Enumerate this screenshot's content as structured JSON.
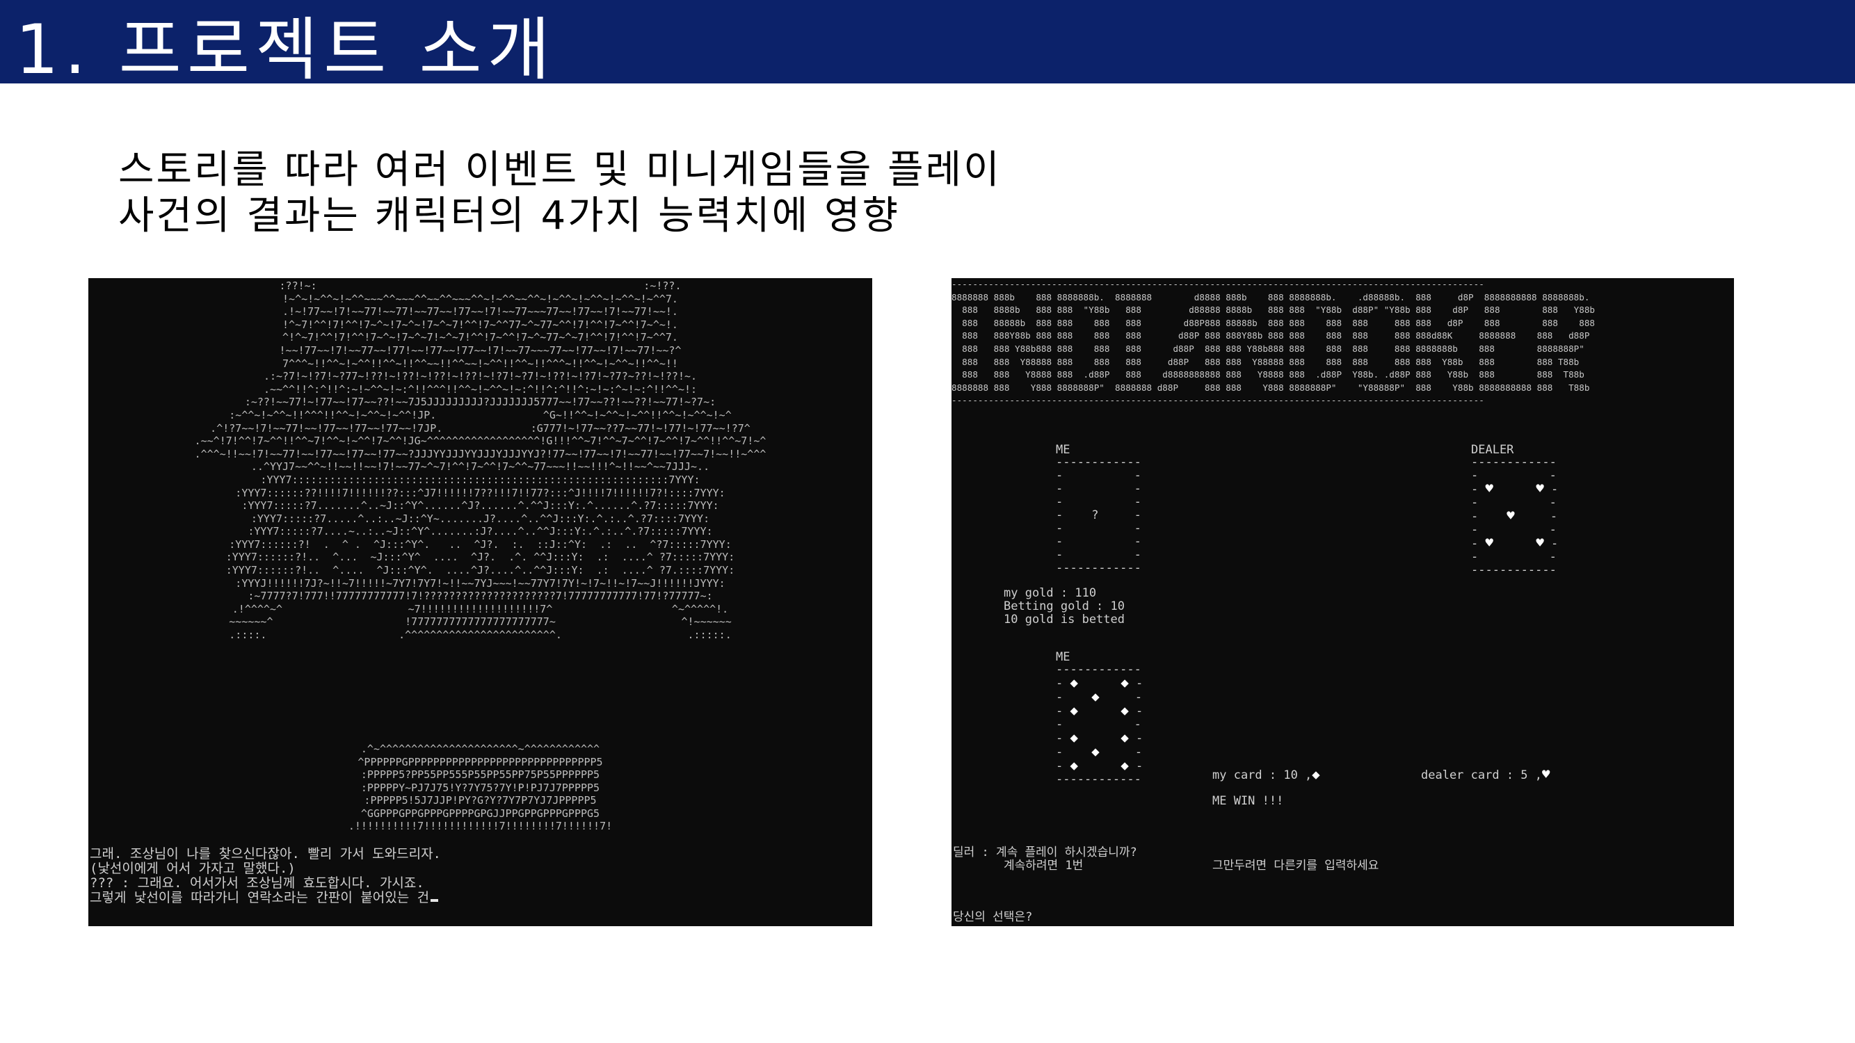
{
  "header": {
    "title": "1. 프로젝트 소개"
  },
  "intro": {
    "line1": "스토리를 따라 여러 이벤트 및 미니게임들을 플레이",
    "line2": "사건의 결과는 캐릭터의 4가지 능력치에 영향"
  },
  "story_console": {
    "ascii_art": ":??!~:                                                    :~!??.\n!~^~!~^^~!~^^~~~^^~~~^^~~^^~~~^^~!~^^~~^^~!~^^~!~^^~!~^^~!~^^7.\n.!~!77~~!7!~~77!~~77!~~77~~!77~~!7!~~77~~~77~~!77~~!7!~~77!~~!.\n!^~7!^^!7!^^!7~^~!7~^~!7~^~7!^^!7~^^77~^~77~^^!7!^^!7~^^!7~^~!.\n^!^~7!^^!7!^^!7~^~!7~^~7!~^~7!^^!7~^^!7~^~77~^~7!^^!7!^^!7~^^7.\n!~~!77~~!7!~~77~~!77!~~!77~~!77~~!7!~~77~~~77~~!77~~!7!~~77!~~?^\n7^^^~!!^^~!~^^!!^^~!!^^~~!!^^~~!~^^!!^^~!!^^^~!!^^~!~^^~!!^^~!!\n.:~?7!~!?7!~?77~!??!~!??!~!??!~!??!~!?7!~?7!~!??!~!?7!~?7?~??!~!??!~.\n.~~^^!!^:^!!^:~!~^^~!~:^!!^^^!!^^~!~^^~!~:^!!^:^!!^:~!~:^~!~:^!!^^~!:\n:~??!~~77!~!77~~!77~~??!~~7J5JJJJJJJJJ?JJJJJJJ5777~~!77~~??!~~??!~~77!~?7~:\n:~^^~!~^^~!!^^^!!^^~!~^^~!~^^!JP.                 ^G~!!^^~!~^^~!~^^!!^^~!~^^~!~^\n.^!?7~~!7!~~77!~~!77~~!77~~!77~~!7JP.              :G777!~!77~~??7~~77!~!77!~!77~~!?7^\n.~~^!7!^^!7~^^!!^^~7!^^~!~^^!7~^^!JG~^^^^^^^^^^^^^^^^^^!G!!!^^~7!^^~7~^^!7~^^!7~^^!!^^~7!~^\n.^^^~!!~~!7!~~77!~~!77~~!77~~!77~~?JJJYYJJJYYJJJYJJJYYJ?!77~~!77~~!7!~~77!~~!77~~7!~~!!~^^^\n..^YYJ7~~^^~!!~~!!~~!7!~~77~^~7!^^!7~^^!7~^^~77~~~!!~~!!!^~!!~~^~~7JJJ~..\n:YYY7::::::::::::::::::::::::::::::::::::::::::::::::::::::::::::7YYY:\n:YYY7::::::??!!!!7!!!!!!??:::^J7!!!!!!7??!!!7!!77?:::^J!!!!7!!!!!!7?!::::7YYY:\n:YYY7:::::?7.......^..~J::^Y^......^J?......^.^^J:::Y:.^......^.?7:::::7YYY:\n:YYY7:::::?7.....^..:..~J::^Y~.......J?....^..^^J:::Y:.^.:..^.?7::::7YYY:\n:YYY7:::::?7....~..:..~J::^Y^.......:J?....^..^^J:::Y:.^.:..^.?7:::::7YYY:\n:YYY7::::::?!  .  ^ .  ^J:::^Y^.   ..  ^J?.  :.  ::J::^Y:  .:  ..  ^?7:::::7YYY:\n:YYY7::::::?!..  ^...  ~J:::^Y^  ....  ^J?.  .^. ^^J:::Y:  .:  ....^ ?7:::::7YYY:\n:YYY7::::::?!..  ^....  ^J:::^Y^.  ....^J?....^..^^J:::Y:  .:  ....^ ?7.::::7YYY:\n:YYYJ!!!!!!7J?~!!~7!!!!!~7Y7!7Y7!~!!~~7YJ~~~!~~77Y7!7Y!~!7~!!~!7~~J!!!!!!JYYY:\n:~7777?7!777!!77777777777!7!?????????????????????7!77777777777!77!?77777~:\n.!^^^^~^                    ~7!!!!!!!!!!!!!!!!!!!7^                   ^~^^^^^!.\n~~~~~~^                     !7777777777777777777777~                    ^!~~~~~~\n.::::.                     .^^^^^^^^^^^^^^^^^^^^^^^^.                    .:::::.",
    "minigame_art": ".^~^^^^^^^^^^^^^^^^^^^^^^~^^^^^^^^^^^^\n^PPPPPPGPPPPPPPPPPPPPPPPPPPPPPPPPPPPPP5\n:PPPPP5?PP55PP555P55PP55PP75P55PPPPPP5\n:PPPPPY~PJ7J75!Y?7Y75?7Y!P!PJ7J7PPPPP5\n:PPPPP5!5J7JJP!PY?G?Y?7Y7P7YJ7JPPPPP5\n^GGPPPGPPGPPPGPPPPGPGJJPPGPPGPPPGPPPG5\n.!!!!!!!!!!7!!!!!!!!!!!!7!!!!!!!!7!!!!!!7!",
    "dialog": [
      "그래. 조상님이 나를 찾으신다잖아. 빨리 가서 도와드리자.",
      "(낯선이에게 어서 가자고 말했다.)",
      "??? : 그래요. 어서가서 조상님께 효도합시다. 가시죠.",
      "그렇게 낯선이를 따라가니 연락소라는 간판이 붙어있는 건"
    ]
  },
  "game_console": {
    "banner": "-----------------------------------------------------------------------------------------------------\n8888888 888b    888 8888888b.  8888888        d8888 888b    888 8888888b.    .d88888b.  888     d8P  8888888888 8888888b.\n  888   8888b   888 888  \"Y88b   888         d88888 8888b   888 888  \"Y88b  d88P\" \"Y88b 888    d8P   888        888   Y88b\n  888   88888b  888 888    888   888        d88P888 88888b  888 888    888  888     888 888   d8P    888        888    888\n  888   888Y88b 888 888    888   888       d88P 888 888Y88b 888 888    888  888     888 888d88K     8888888    888   d88P\n  888   888 Y88b888 888    888   888      d88P  888 888 Y88b888 888    888  888     888 8888888b    888        8888888P\"\n  888   888  Y88888 888    888   888     d88P   888 888  Y88888 888    888  888     888 888  Y88b   888        888 T88b\n  888   888   Y8888 888  .d88P   888    d8888888888 888   Y8888 888  .d88P  Y88b. .d88P 888   Y88b  888        888  T88b\n8888888 888    Y888 8888888P\"  8888888 d88P     888 888    Y888 8888888P\"    \"Y88888P\"  888    Y88b 8888888888 888   T88b\n-----------------------------------------------------------------------------------------------------",
    "me_label_top": "ME",
    "dealer_label": "DEALER",
    "hidden_card_symbol": "?",
    "suit_heart": "♥",
    "suit_diamond": "◆",
    "my_gold": "my gold : 110",
    "betting_gold": "Betting gold : 10",
    "gold_betted": "10 gold is betted",
    "me_label_bottom": "ME",
    "my_card": "my card : 10 ,",
    "dealer_card": "dealer card : 5 ,",
    "result": "ME WIN !!!",
    "prompt_line1": "딜러 : 계속 플레이 하시겠습니까?",
    "prompt_line2": "계속하려면 1번",
    "quit_hint": "그만두려면 다른키를 입력하세요",
    "choice_prompt": "당신의 선택은?"
  }
}
